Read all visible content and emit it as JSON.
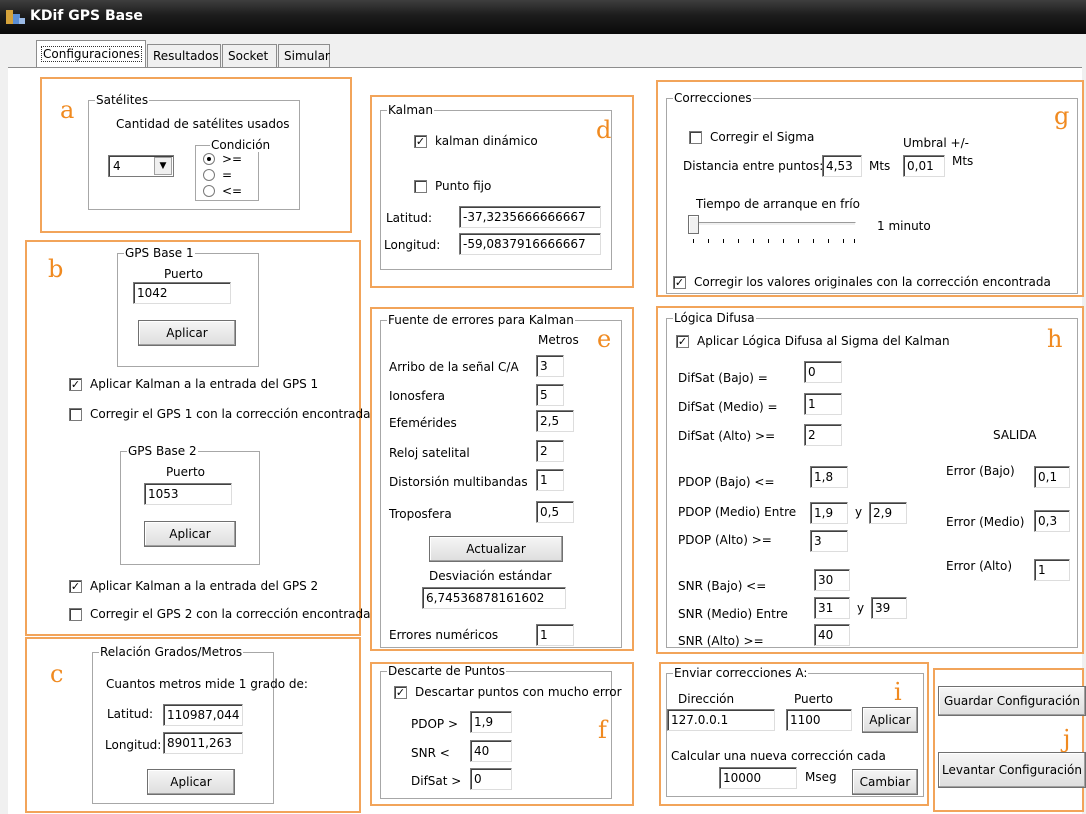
{
  "window": {
    "title": "KDif GPS Base"
  },
  "tabs": [
    "Configuraciones",
    "Resultados",
    "Socket",
    "Simular"
  ],
  "markers": {
    "a": "a",
    "b": "b",
    "c": "c",
    "d": "d",
    "e": "e",
    "f": "f",
    "g": "g",
    "h": "h",
    "i": "i",
    "j": "j"
  },
  "satelites": {
    "group": "Satélites",
    "caption": "Cantidad de satélites usados",
    "count": "4",
    "condicion_label": "Condición",
    "options": [
      ">=",
      "=",
      "<="
    ],
    "selected": ">="
  },
  "gps1": {
    "group": "GPS Base 1",
    "puerto_label": "Puerto",
    "puerto": "1042",
    "apply": "Aplicar",
    "kalman": "Aplicar Kalman a la entrada del GPS 1",
    "kalman_checked": true,
    "corregir": "Corregir el GPS 1 con la corrección encontrada",
    "corregir_checked": false
  },
  "gps2": {
    "group": "GPS Base 2",
    "puerto_label": "Puerto",
    "puerto": "1053",
    "apply": "Aplicar",
    "kalman": "Aplicar Kalman a la entrada del GPS 2",
    "kalman_checked": true,
    "corregir": "Corregir el GPS 2 con la corrección encontrada",
    "corregir_checked": false
  },
  "relacion": {
    "group": "Relación Grados/Metros",
    "caption": "Cuantos metros mide 1 grado de:",
    "lat_label": "Latitud:",
    "lat": "110987,044",
    "lon_label": "Longitud:",
    "lon": "89011,263",
    "apply": "Aplicar"
  },
  "kalman": {
    "group": "Kalman",
    "dinamico": "kalman dinámico",
    "dinamico_checked": true,
    "punto_fijo": "Punto fijo",
    "punto_fijo_checked": false,
    "lat_label": "Latitud:",
    "lat": "-37,3235666666667",
    "lon_label": "Longitud:",
    "lon": "-59,0837916666667"
  },
  "fuente": {
    "group": "Fuente de errores para Kalman",
    "metros": "Metros",
    "rows": [
      {
        "label": "Arribo de la señal C/A",
        "value": "3"
      },
      {
        "label": "Ionosfera",
        "value": "5"
      },
      {
        "label": "Efemérides",
        "value": "2,5"
      },
      {
        "label": "Reloj satelital",
        "value": "2"
      },
      {
        "label": "Distorsión multibandas",
        "value": "1"
      },
      {
        "label": "Troposfera",
        "value": "0,5"
      }
    ],
    "actualizar": "Actualizar",
    "desv_label": "Desviación estándar",
    "desv": "6,74536878161602",
    "errores_label": "Errores numéricos",
    "errores": "1"
  },
  "descarte": {
    "group": "Descarte de Puntos",
    "check": "Descartar puntos con mucho error",
    "checked": true,
    "pdop_label": "PDOP >",
    "pdop": "1,9",
    "snr_label": "SNR <",
    "snr": "40",
    "difsat_label": "DifSat >",
    "difsat": "0"
  },
  "correcciones": {
    "group": "Correcciones",
    "sigma": "Corregir el Sigma",
    "sigma_checked": false,
    "umbral_label": "Umbral +/-",
    "dist_label": "Distancia entre puntos:",
    "dist": "4,53",
    "mts": "Mts",
    "umbral": "0,01",
    "mts2": "Mts",
    "arranque_label": "Tiempo de arranque en frío",
    "arranque_value": "1 minuto",
    "slider_position": 0,
    "corregir_valores": "Corregir los valores originales con la corrección encontrada",
    "corregir_valores_checked": true
  },
  "difusa": {
    "group": "Lógica Difusa",
    "check": "Aplicar Lógica Difusa al Sigma del Kalman",
    "checked": true,
    "difsat_bajo_label": "DifSat (Bajo) =",
    "difsat_bajo": "0",
    "difsat_medio_label": "DifSat (Medio) =",
    "difsat_medio": "1",
    "difsat_alto_label": "DifSat (Alto) >=",
    "difsat_alto": "2",
    "salida": "SALIDA",
    "pdop_bajo_label": "PDOP (Bajo) <=",
    "pdop_bajo": "1,8",
    "pdop_medio_label": "PDOP (Medio) Entre",
    "pdop_medio_a": "1,9",
    "y1": "y",
    "pdop_medio_b": "2,9",
    "pdop_alto_label": "PDOP (Alto) >=",
    "pdop_alto": "3",
    "snr_bajo_label": "SNR (Bajo) <=",
    "snr_bajo": "30",
    "snr_medio_label": "SNR (Medio) Entre",
    "snr_medio_a": "31",
    "y2": "y",
    "snr_medio_b": "39",
    "snr_alto_label": "SNR (Alto) >=",
    "snr_alto": "40",
    "err_bajo_label": "Error (Bajo)",
    "err_bajo": "0,1",
    "err_medio_label": "Error (Medio)",
    "err_medio": "0,3",
    "err_alto_label": "Error (Alto)",
    "err_alto": "1"
  },
  "enviar": {
    "group": "Enviar correcciones A:",
    "dir_label": "Dirección",
    "dir": "127.0.0.1",
    "puerto_label": "Puerto",
    "puerto": "1100",
    "apply": "Aplicar",
    "calc_label": "Calcular una nueva corrección cada",
    "mseg_val": "10000",
    "mseg": "Mseg",
    "cambiar": "Cambiar"
  },
  "config": {
    "guardar": "Guardar Configuración",
    "levantar": "Levantar Configuración"
  },
  "colors": {
    "accent": "#f2a45a",
    "marker": "#f08a20",
    "titlebar": "#1c1c1c"
  }
}
